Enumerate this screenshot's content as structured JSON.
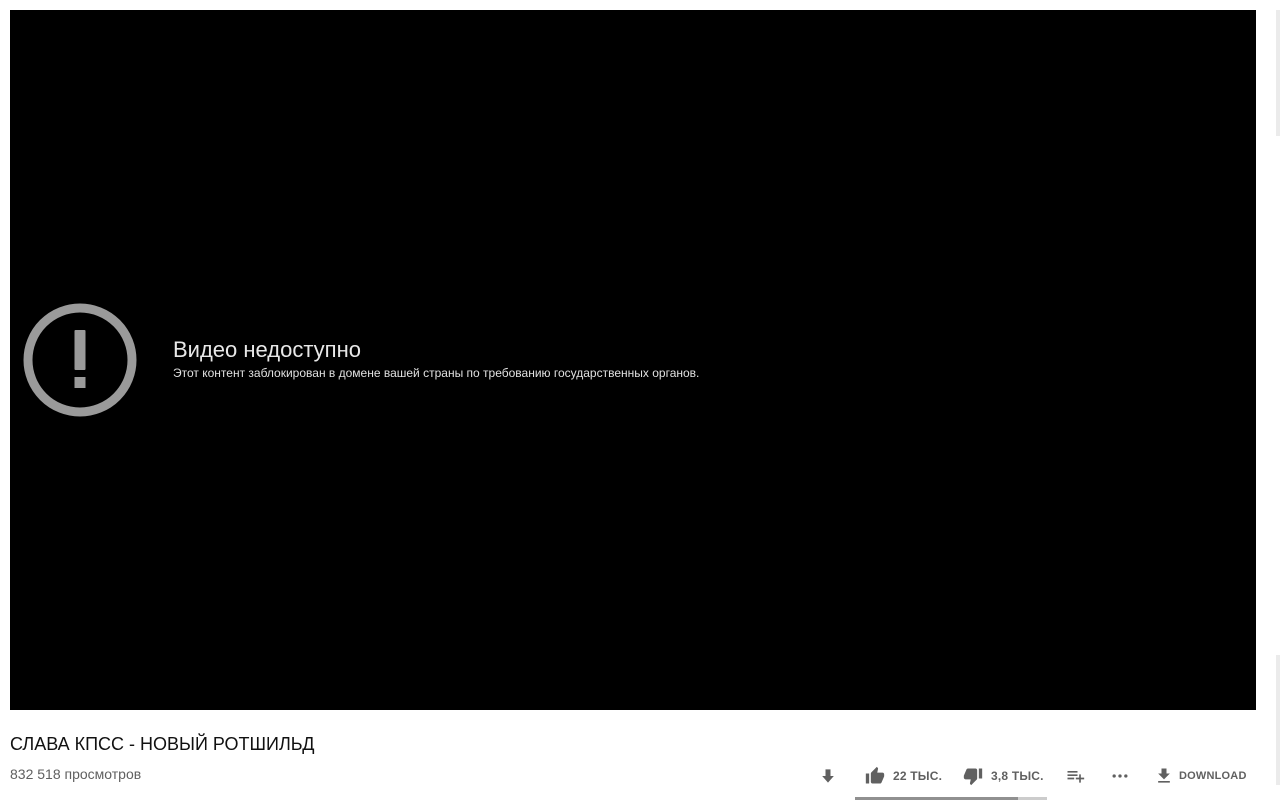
{
  "player": {
    "error_title": "Видео недоступно",
    "error_message": "Этот контент заблокирован в домене вашей страны по требованию государственных органов.",
    "error_icon": "alert-circle-icon"
  },
  "video": {
    "title": "СЛАВА КПСС - НОВЫЙ РОТШИЛЬД",
    "views": "832 518 просмотров"
  },
  "actions": {
    "save_icon": "download-arrow-icon",
    "like_count": "22 ТЫС.",
    "dislike_count": "3,8 ТЫС.",
    "add_to_playlist_icon": "playlist-add-icon",
    "more_icon": "more-horizontal-icon",
    "download_label": "DOWNLOAD"
  },
  "sentiment": {
    "like_fraction": 0.85
  },
  "colors": {
    "player_bg": "#000000",
    "icon_gray": "#9a9a9a",
    "action_gray": "#606060"
  }
}
